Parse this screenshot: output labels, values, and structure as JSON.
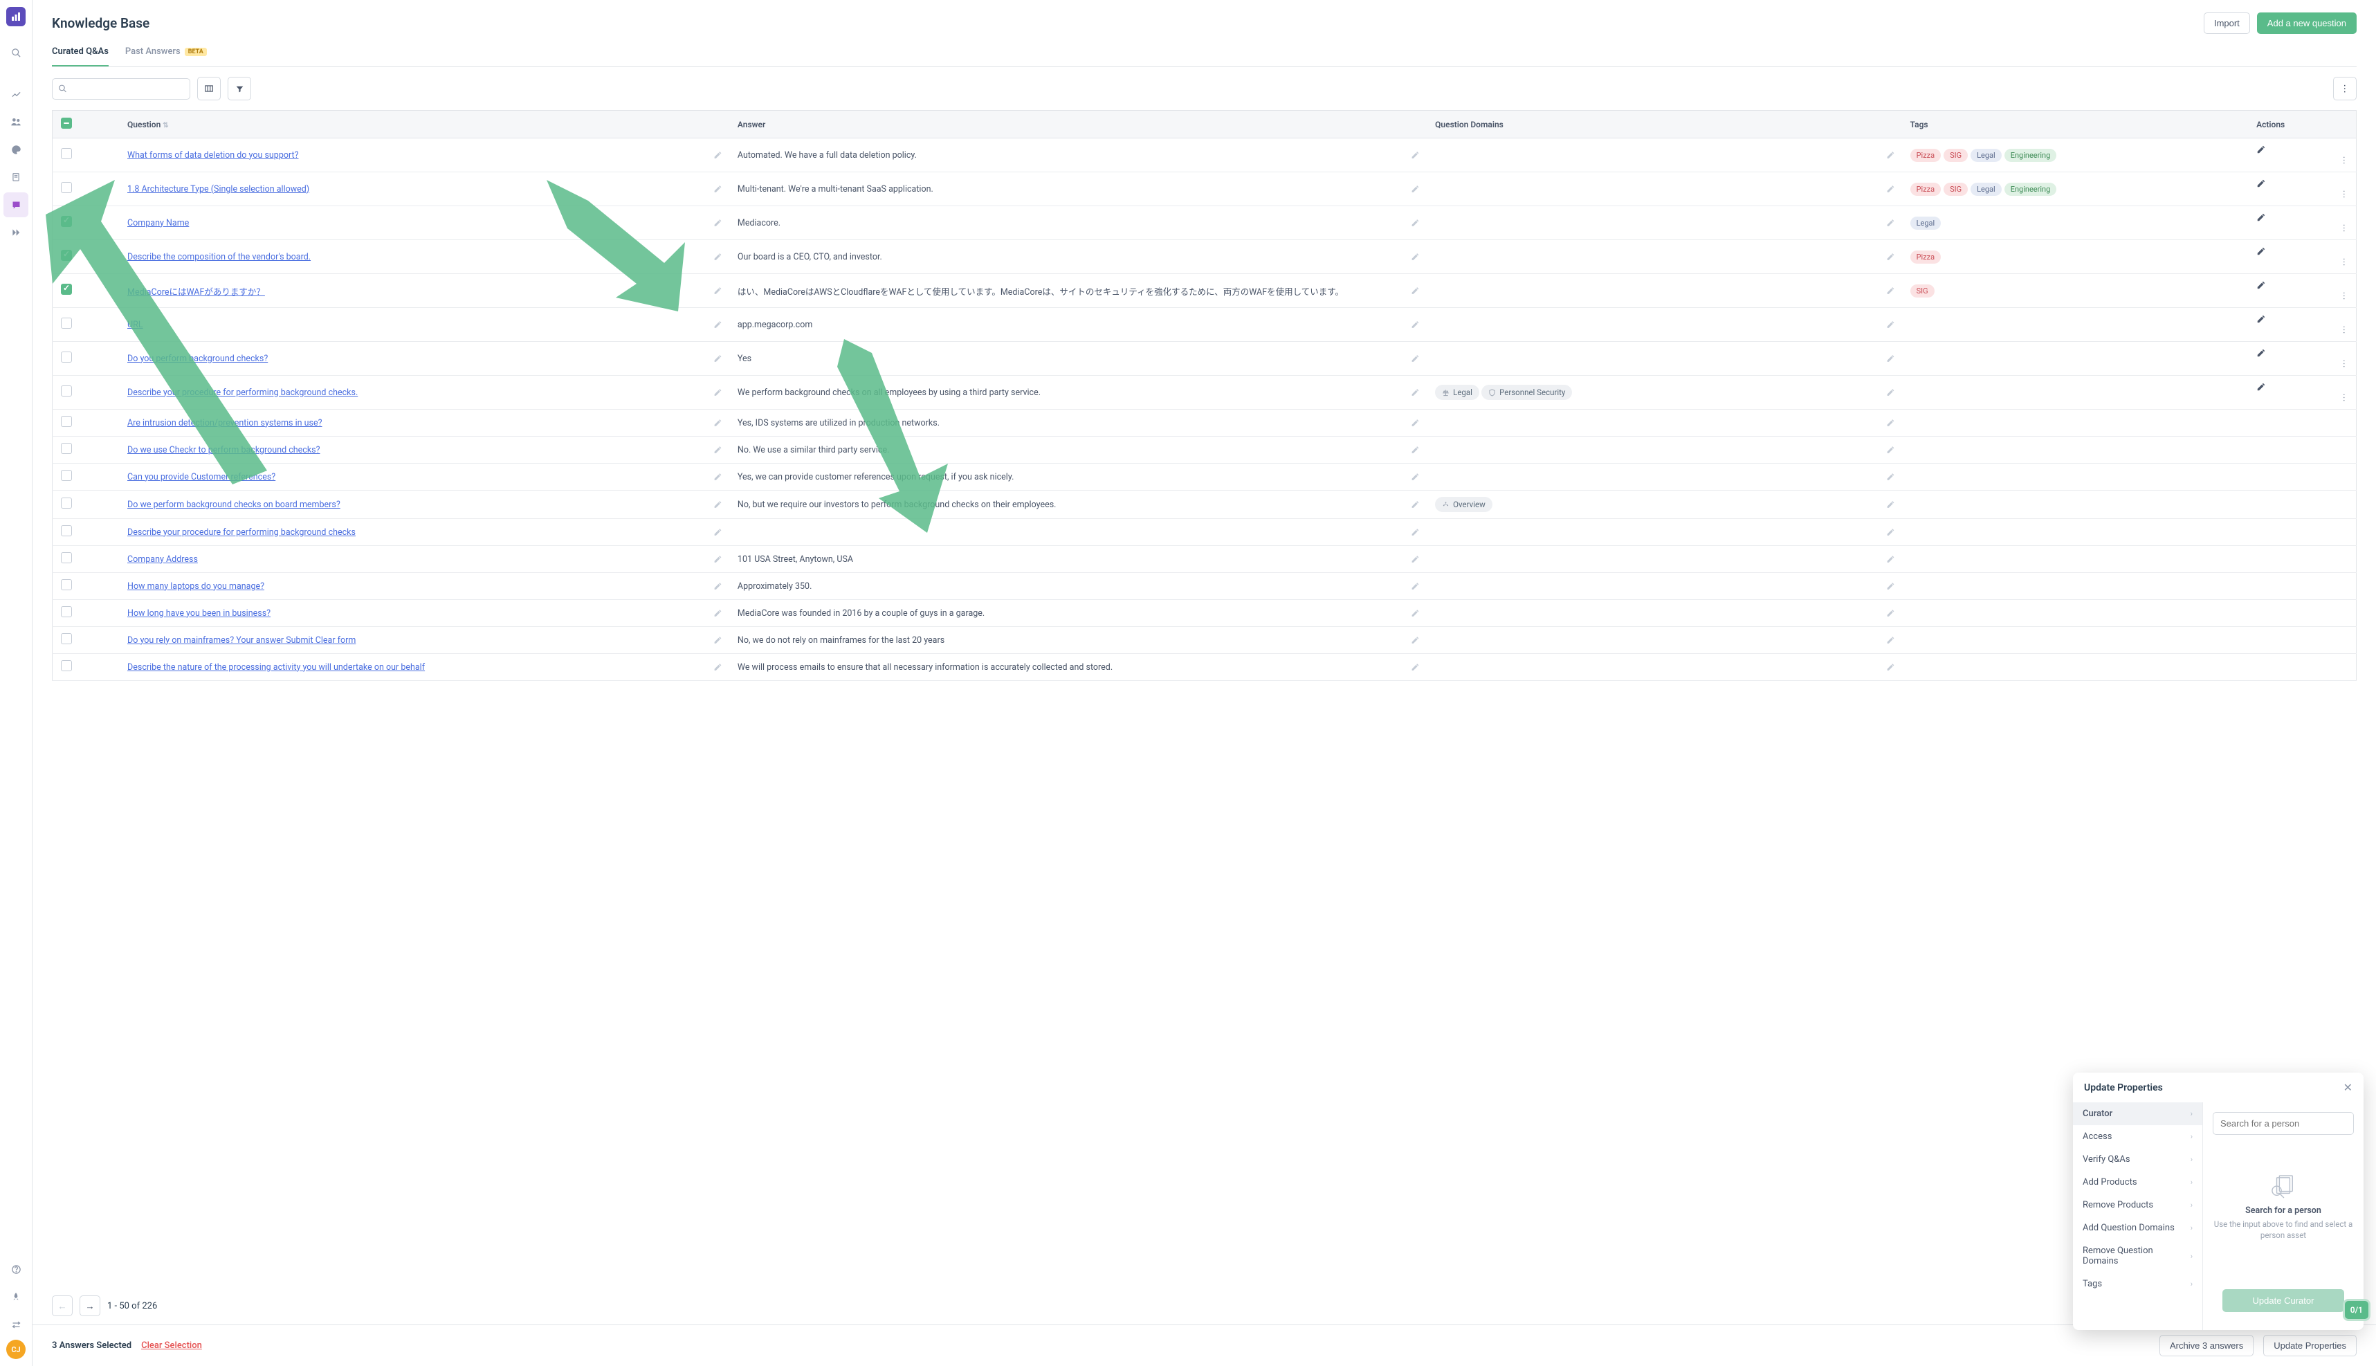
{
  "page_title": "Knowledge Base",
  "header": {
    "import_label": "Import",
    "add_label": "Add a new question"
  },
  "tabs": [
    {
      "label": "Curated Q&As",
      "active": true
    },
    {
      "label": "Past Answers",
      "beta": "BETA",
      "active": false
    }
  ],
  "search": {
    "placeholder": ""
  },
  "columns": {
    "question": "Question",
    "answer": "Answer",
    "domains": "Question Domains",
    "tags": "Tags",
    "actions": "Actions"
  },
  "pagination": {
    "text": "1 - 50 of 226"
  },
  "footer": {
    "selected": "3 Answers Selected",
    "clear": "Clear Selection",
    "archive": "Archive 3 answers",
    "update": "Update Properties"
  },
  "progress_badge": "0/1",
  "avatar_initials": "CJ",
  "popover": {
    "title": "Update Properties",
    "menu": [
      "Curator",
      "Access",
      "Verify Q&As",
      "Add Products",
      "Remove Products",
      "Add Question Domains",
      "Remove Question Domains",
      "Tags"
    ],
    "active_menu": 0,
    "search_placeholder": "Search for a person",
    "empty_title": "Search for a person",
    "empty_sub": "Use the input above to find and select a person asset",
    "update_label": "Update Curator"
  },
  "rows": [
    {
      "checked": false,
      "q": "What forms of data deletion do you support?",
      "a": "Automated. We have a full data deletion policy.",
      "domains": [],
      "tags": [
        "Pizza",
        "SIG",
        "Legal",
        "Engineering"
      ],
      "actions": true
    },
    {
      "checked": false,
      "q": "1.8 Architecture Type (Single selection allowed)",
      "a": "Multi-tenant. We're a multi-tenant SaaS application.",
      "domains": [],
      "tags": [
        "Pizza",
        "SIG",
        "Legal",
        "Engineering"
      ],
      "actions": true
    },
    {
      "checked": true,
      "q": "Company Name",
      "a": "Mediacore.",
      "domains": [],
      "tags": [
        "Legal"
      ],
      "actions": true
    },
    {
      "checked": true,
      "q": "Describe the composition of the vendor's board.",
      "a": "Our board is a CEO, CTO, and investor.",
      "domains": [],
      "tags": [
        "Pizza"
      ],
      "actions": true
    },
    {
      "checked": true,
      "q": "MediaCoreにはWAFがありますか？",
      "a": "はい、MediaCoreはAWSとCloudflareをWAFとして使用しています。MediaCoreは、サイトのセキュリティを強化するために、両方のWAFを使用しています。",
      "domains": [],
      "tags": [
        "SIG"
      ],
      "actions": true
    },
    {
      "checked": false,
      "q": "URL",
      "a": "app.megacorp.com",
      "domains": [],
      "tags": [],
      "actions": true
    },
    {
      "checked": false,
      "q": "Do you perform background checks?",
      "a": "Yes",
      "domains": [],
      "tags": [],
      "actions": true
    },
    {
      "checked": false,
      "q": "Describe your procedure for performing background checks.",
      "a": "We perform background checks on all employees by using a third party service.",
      "domains": [
        {
          "icon": "balance",
          "label": "Legal"
        },
        {
          "icon": "shield",
          "label": "Personnel Security"
        }
      ],
      "tags": [],
      "actions": true
    },
    {
      "checked": false,
      "q": "Are intrusion detection/prevention systems in use?",
      "a": "Yes, IDS systems are utilized in production networks.",
      "domains": [],
      "tags": []
    },
    {
      "checked": false,
      "q": "Do we use Checkr to perform background checks?",
      "a": "No. We use a similar third party service.",
      "domains": [],
      "tags": []
    },
    {
      "checked": false,
      "q": "Can you provide Customer references?",
      "a": "Yes, we can provide customer references upon request, if you ask nicely.",
      "domains": [],
      "tags": []
    },
    {
      "checked": false,
      "q": "Do we perform background checks on board members?",
      "a": "No, but we require our investors to perform background checks on their employees.",
      "domains": [
        {
          "icon": "org",
          "label": "Overview"
        }
      ],
      "tags": []
    },
    {
      "checked": false,
      "q": "Describe your procedure for performing background checks",
      "a": "",
      "domains": [],
      "tags": []
    },
    {
      "checked": false,
      "q": "Company Address",
      "a": "101 USA Street, Anytown, USA",
      "domains": [],
      "tags": []
    },
    {
      "checked": false,
      "q": "How many laptops do you manage?",
      "a": "Approximately 350.",
      "domains": [],
      "tags": []
    },
    {
      "checked": false,
      "q": "How long have you been in business?",
      "a": "MediaCore was founded in 2016 by a couple of guys in a garage.",
      "domains": [],
      "tags": []
    },
    {
      "checked": false,
      "q": "Do you rely on mainframes? Your answer Submit Clear form",
      "a": "No, we do not rely on mainframes for the last 20 years",
      "domains": [],
      "tags": []
    },
    {
      "checked": false,
      "q": "Describe the nature of the processing activity you will undertake on our behalf",
      "a": "We will process emails to ensure that all necessary information is accurately collected and stored.",
      "domains": [],
      "tags": []
    }
  ]
}
